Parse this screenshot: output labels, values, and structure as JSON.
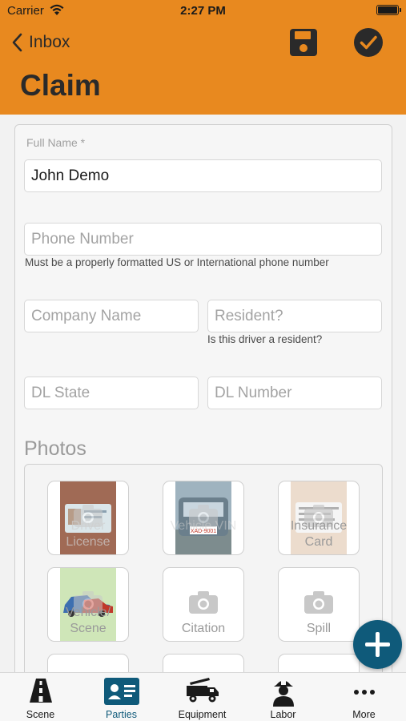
{
  "status_bar": {
    "carrier": "Carrier",
    "time": "2:27 PM"
  },
  "nav": {
    "back_label": "Inbox",
    "title": "Claim"
  },
  "form": {
    "full_name_label": "Full Name *",
    "full_name_value": "John Demo",
    "phone_placeholder": "Phone Number",
    "phone_helper": "Must be a properly formatted US or International phone number",
    "company_placeholder": "Company Name",
    "resident_placeholder": "Resident?",
    "resident_helper": "Is this driver a resident?",
    "dl_state_placeholder": "DL State",
    "dl_number_placeholder": "DL Number"
  },
  "photos": {
    "title": "Photos",
    "tiles": [
      {
        "label": "Driver License",
        "has_image": true
      },
      {
        "label": "Vehicle VIN",
        "has_image": true
      },
      {
        "label": "Insurance Card",
        "has_image": true
      },
      {
        "label": "Vehicle/ Scene",
        "has_image": true
      },
      {
        "label": "Citation",
        "has_image": false
      },
      {
        "label": "Spill",
        "has_image": false
      }
    ]
  },
  "tabbar": {
    "active": "Parties",
    "tabs": [
      {
        "label": "Scene",
        "icon": "road-icon"
      },
      {
        "label": "Parties",
        "icon": "id-card-icon"
      },
      {
        "label": "Equipment",
        "icon": "fire-truck-icon"
      },
      {
        "label": "Labor",
        "icon": "firefighter-icon"
      },
      {
        "label": "More",
        "icon": "more-dots-icon"
      }
    ]
  },
  "colors": {
    "header": "#e8891f",
    "accent": "#0f5a7a",
    "text_dark": "#2a2a2a"
  }
}
